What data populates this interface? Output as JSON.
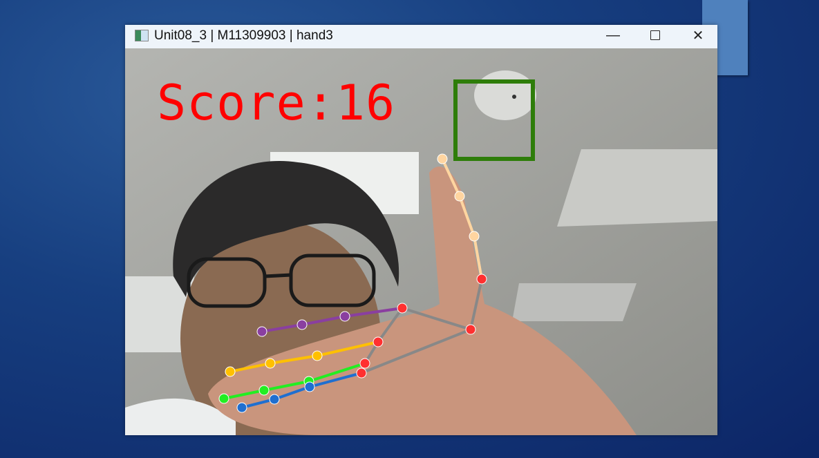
{
  "window": {
    "title": "Unit08_3 | M11309903 | hand3",
    "minimize_icon": "minimize-icon",
    "maximize_icon": "maximize-icon",
    "close_icon": "close-icon"
  },
  "game": {
    "score_text": "Score:16",
    "target_color": "#2e7d0a",
    "score_color": "#ff0000"
  }
}
